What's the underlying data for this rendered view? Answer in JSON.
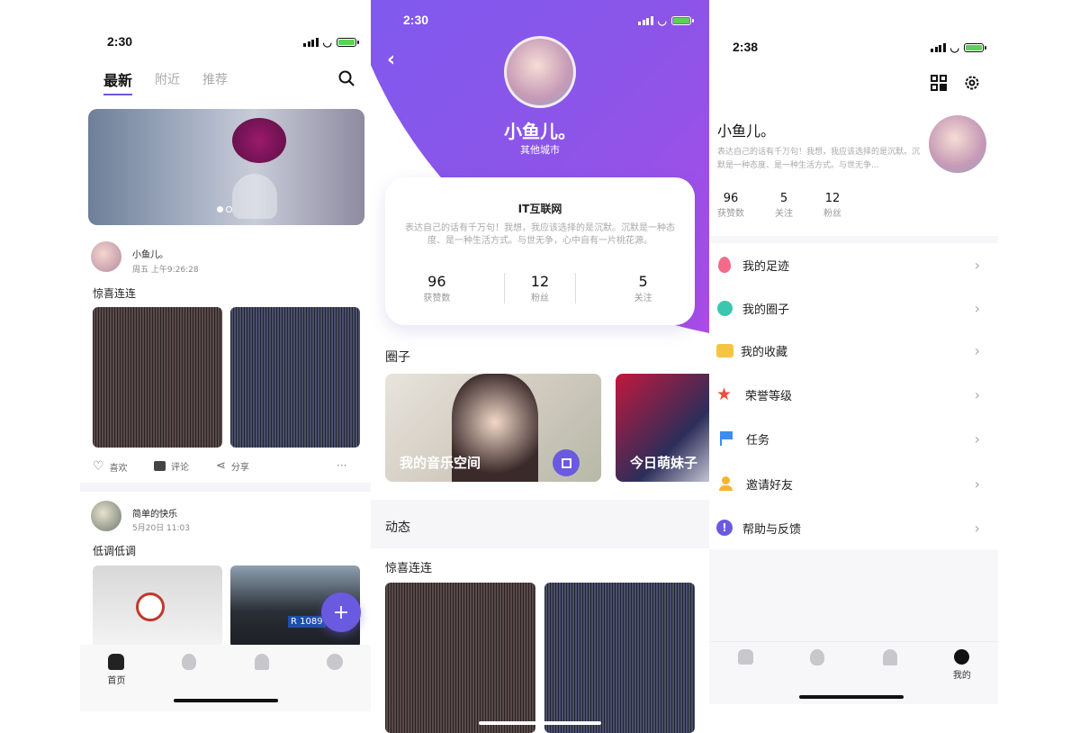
{
  "left": {
    "status_time": "2:30",
    "tabs": [
      "最新",
      "附近",
      "推荐"
    ],
    "posts": [
      {
        "author": "小鱼儿。",
        "time": "周五 上午9:26:28",
        "text": "惊喜连连"
      },
      {
        "author": "简单的快乐",
        "time": "5月20日 11:03",
        "text": "低调低调"
      }
    ],
    "actions": {
      "like": "喜欢",
      "comment": "评论",
      "share": "分享",
      "more": "···"
    },
    "plate_text": "R 1089",
    "fab": "+",
    "tabbar": {
      "home": "首页"
    }
  },
  "middle": {
    "status_time": "2:30",
    "name": "小鱼儿。",
    "city": "其他城市",
    "card_title": "IT互联网",
    "bio": "表达自己的话有千万句！我想，我应该选择的是沉默。沉默是一种态度、是一种生活方式。与世无争，心中自有一片桃花源。",
    "stats": [
      {
        "value": "96",
        "label": "获赞数"
      },
      {
        "value": "12",
        "label": "粉丝"
      },
      {
        "value": "5",
        "label": "关注"
      }
    ],
    "circles_title": "圈子",
    "circles": [
      "我的音乐空间",
      "今日萌妹子"
    ],
    "dynamic_title": "动态",
    "post_text": "惊喜连连"
  },
  "right": {
    "status_time": "2:38",
    "name": "小鱼儿。",
    "bio": "表达自己的话有千万句！我想，我应该选择的是沉默。沉默是一种态度、是一种生活方式。与世无争...",
    "stats": [
      {
        "value": "96",
        "label": "获赞数"
      },
      {
        "value": "5",
        "label": "关注"
      },
      {
        "value": "12",
        "label": "粉丝"
      }
    ],
    "menu": [
      {
        "label": "我的足迹",
        "icon": "pin-icon",
        "color": "#f26b8a"
      },
      {
        "label": "我的圈子",
        "icon": "circle-icon",
        "color": "#3cc6b0"
      },
      {
        "label": "我的收藏",
        "icon": "folder-icon",
        "color": "#f5c542"
      },
      {
        "label": "荣誉等级",
        "icon": "star-icon",
        "color": "#e8503a"
      },
      {
        "label": "任务",
        "icon": "flag-icon",
        "color": "#3d8bf0"
      },
      {
        "label": "邀请好友",
        "icon": "add-friend-icon",
        "color": "#f5b431"
      },
      {
        "label": "帮助与反馈",
        "icon": "help-icon",
        "color": "#6a5ae0"
      }
    ],
    "tabbar": {
      "mine": "我的"
    }
  },
  "colors": {
    "accent": "#6a5ae0",
    "purple_start": "#7b5cf0",
    "purple_end": "#b44ae8"
  }
}
